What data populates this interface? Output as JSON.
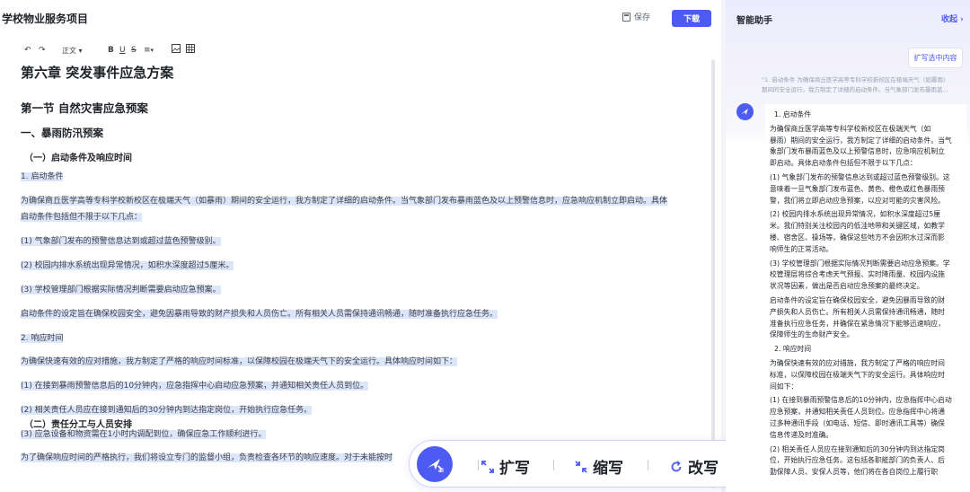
{
  "header": {
    "doc_title": "学校物业服务项目",
    "save_label": "保存",
    "download_label": "下载"
  },
  "toolbar": {
    "style_label": "正文",
    "bold": "B",
    "underline": "U",
    "strike": "S"
  },
  "doc": {
    "chapter": "第六章 突发事件应急方案",
    "section": "第一节 自然灾害应急预案",
    "subsection": "一、暴雨防汛预案",
    "item1_title": "（一）启动条件及响应时间",
    "item2_title": "（二）责任分工与人员安排",
    "paragraphs": [
      "1. 启动条件",
      "为确保商丘医学高等专科学校新校区在极端天气（如暴雨）期间的安全运行，我方制定了详细的启动条件。当气象部门发布暴雨蓝色及以上预警信息时，应急响应机制立即启动。具体",
      "启动条件包括但不限于以下几点：",
      "(1) 气象部门发布的预警信息达到或超过蓝色预警级别。",
      "(2) 校园内排水系统出现异常情况，如积水深度超过5厘米。",
      "(3) 学校管理部门根据实际情况判断需要启动应急预案。",
      "启动条件的设定旨在确保校园安全，避免因暴雨导致的财产损失和人员伤亡。所有相关人员需保持通讯畅通，随时准备执行应急任务。",
      "2. 响应时间",
      "为确保快速有效的应对措施，我方制定了严格的响应时间标准，以保障校园在极端天气下的安全运行。具体响应时间如下：",
      "(1) 在接到暴雨预警信息后的10分钟内，应急指挥中心启动应急预案，并通知相关责任人员到位。",
      "(2) 相关责任人员应在接到通知后的30分钟内到达指定岗位，开始执行应急任务。",
      "(3) 应急设备和物资需在1小时内调配到位，确保应急工作顺利进行。",
      "为了确保响应时间的严格执行，我们将设立专门的监督小组，负责检查各环节的响应速度。对于未能按时"
    ]
  },
  "floatbar": {
    "expand_label": "扩写",
    "shrink_label": "缩写",
    "rewrite_label": "改写"
  },
  "assistant": {
    "title": "智能助手",
    "collapse_label": "收起",
    "expand_selected_label": "扩写选中内容",
    "quote_line1": "\"1. 启动条件 为确保商丘医学高等专科学校新校区在极端天气（如暴雨）",
    "quote_line2": "期间的安全运行，我方制定了详细的启动条件。当气象部门发布暴雨蓝...",
    "answer_lines": [
      "1. 启动条件",
      "为确保商丘医学高等专科学校新校区在极端天气（如",
      "暴雨）期间的安全运行，我方制定了详细的启动条件。当气",
      "象部门发布暴雨蓝色及以上预警信息时，应急响应机制立",
      "即启动。具体启动条件包括但不限于以下几点：",
      "(1) 气象部门发布的预警信息达到或超过蓝色预警级别。这",
      "意味着一旦气象部门发布蓝色、黄色、橙色或红色暴雨预",
      "警，我们将立即启动应急预案，以应对可能的灾害风险。",
      "(2) 校园内排水系统出现异常情况，如积水深度超过5厘",
      "米。我们特别关注校园内的低洼地带和关键区域，如教学",
      "楼、宿舍区、操场等，确保这些地方不会因积水过深而影",
      "响师生的正常活动。",
      "(3) 学校管理部门根据实际情况判断需要启动应急预案。学",
      "校管理层将综合考虑天气预报、实时降雨量、校园内设施",
      "状况等因素，做出是否启动应急预案的最终决定。",
      "启动条件的设定旨在确保校园安全，避免因暴雨导致的财",
      "产损失和人员伤亡。所有相关人员需保持通讯畅通，随时",
      "准备执行应急任务，并确保在紧急情况下能够迅速响应，",
      "保障师生的生命财产安全。",
      "2. 响应时间",
      "为确保快速有效的应对措施，我方制定了严格的响应时间",
      "标准，以保障校园在极端天气下的安全运行。具体响应时",
      "间如下：",
      "(1) 在接到暴雨预警信息后的10分钟内，应急指挥中心启动",
      "应急预案，并通知相关责任人员到位。应急指挥中心将通",
      "过多种通讯手段（如电话、短信、即时通讯工具等）确保",
      "信息传递及时准确。",
      "(2) 相关责任人员应在接到通知后的30分钟内到达指定岗",
      "位，开始执行应急任务。这包括各职能部门的负责人、后",
      "勤保障人员、安保人员等，他们将在各自岗位上履行职"
    ]
  },
  "colors": {
    "accent": "#4e5bf2",
    "highlight": "#dce6fb"
  }
}
